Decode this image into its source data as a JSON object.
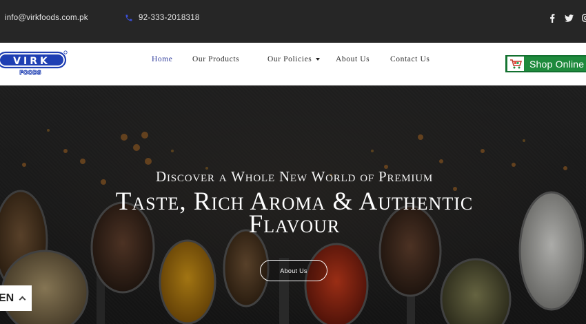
{
  "topbar": {
    "email": "info@virkfoods.com.pk",
    "phone": "92-333-2018318",
    "social_icons": [
      "facebook-icon",
      "twitter-icon",
      "instagram-icon"
    ]
  },
  "nav": {
    "logo_text": "VIRK",
    "logo_subtext": "FOODS",
    "items": [
      {
        "label": "Home",
        "active": true
      },
      {
        "label": "Our Products"
      },
      {
        "label": "Our Policies",
        "has_dropdown": true
      },
      {
        "label": "About Us"
      },
      {
        "label": "Contact Us"
      }
    ],
    "shop_button": "Shop Online"
  },
  "hero": {
    "line1": "Discover a Whole New World of Premium",
    "line2a": "Taste, Rich Aroma & Authentic",
    "line2b": "Flavour",
    "button": "About Us"
  },
  "language": {
    "label": "EN"
  },
  "colors": {
    "topbar_bg": "#262626",
    "nav_active": "#2f3c9c",
    "shop_green": "#1e8a3c",
    "logo_blue": "#1f3fb3"
  }
}
